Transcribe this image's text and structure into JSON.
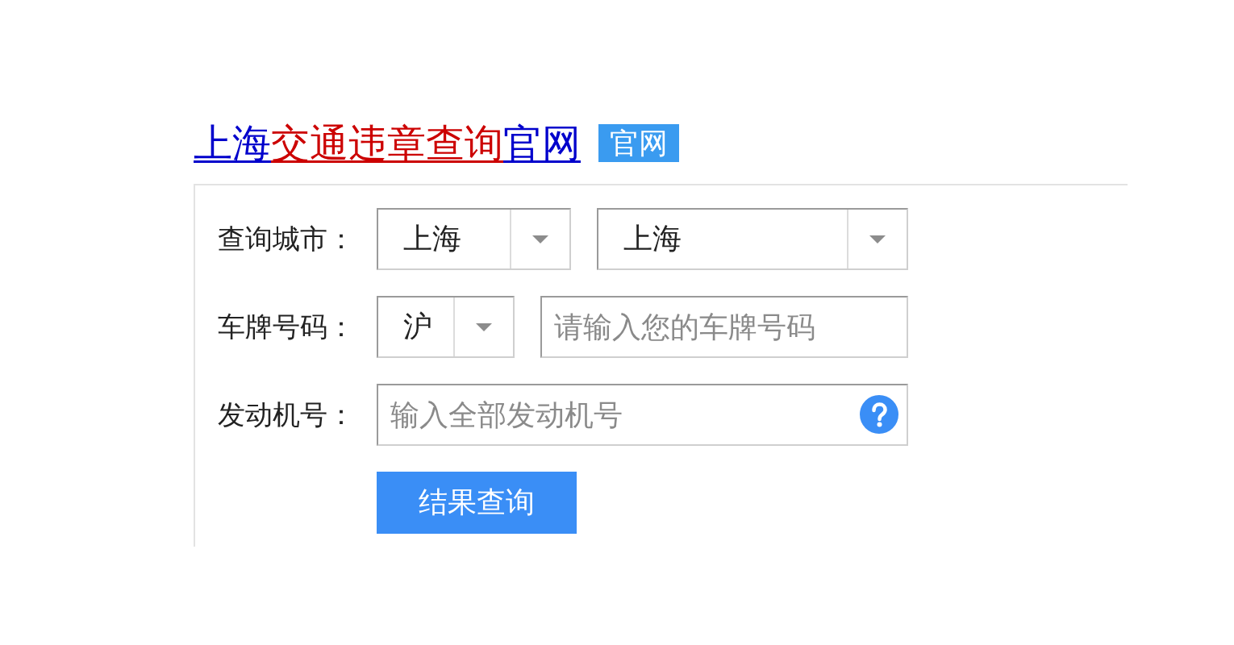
{
  "title": {
    "segments": [
      {
        "text": "上海",
        "color": "#0000cc"
      },
      {
        "text": "交通违章查询",
        "color": "#cc0000"
      },
      {
        "text": "官网",
        "color": "#0000cc"
      }
    ]
  },
  "badge": "官网",
  "form": {
    "rows": [
      {
        "label": "查询城市：",
        "controls": [
          {
            "kind": "select",
            "value": "上海"
          },
          {
            "kind": "select",
            "value": "上海"
          }
        ]
      },
      {
        "label": "车牌号码：",
        "controls": [
          {
            "kind": "select",
            "value": "沪"
          },
          {
            "kind": "input",
            "placeholder": "请输入您的车牌号码",
            "help": false
          }
        ]
      },
      {
        "label": "发动机号：",
        "controls": [
          {
            "kind": "input",
            "placeholder": "输入全部发动机号",
            "help": true
          }
        ]
      }
    ],
    "submit": "结果查询"
  }
}
